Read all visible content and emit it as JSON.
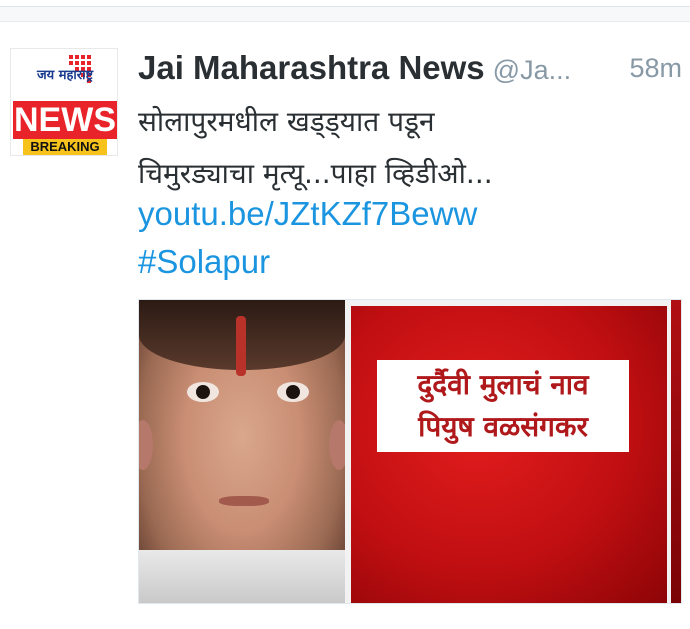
{
  "tweet": {
    "author": "Jai Maharashtra News",
    "handle": "@Ja...",
    "time": "58m",
    "text_lines": [
      "सोलापुरमधील खड्ड्यात पडून",
      "चिमुरड्याचा मृत्यू...पाहा व्हिडीओ..."
    ],
    "link": "youtu.be/JZtKZf7Beww",
    "hashtag": "#Solapur"
  },
  "avatar": {
    "brand_text": "जय महाराष्ट्र",
    "news_label": "NEWS",
    "breaking_label": "BREAKING"
  },
  "media": {
    "caption_lines": [
      "दुर्दैवी मुलाचं नाव",
      "पियुष वळसंगकर"
    ]
  },
  "colors": {
    "link": "#1b95e0",
    "text": "#292f33",
    "muted": "#8899a6",
    "news_red": "#e8232a",
    "breaking_yellow": "#f6c21b"
  }
}
